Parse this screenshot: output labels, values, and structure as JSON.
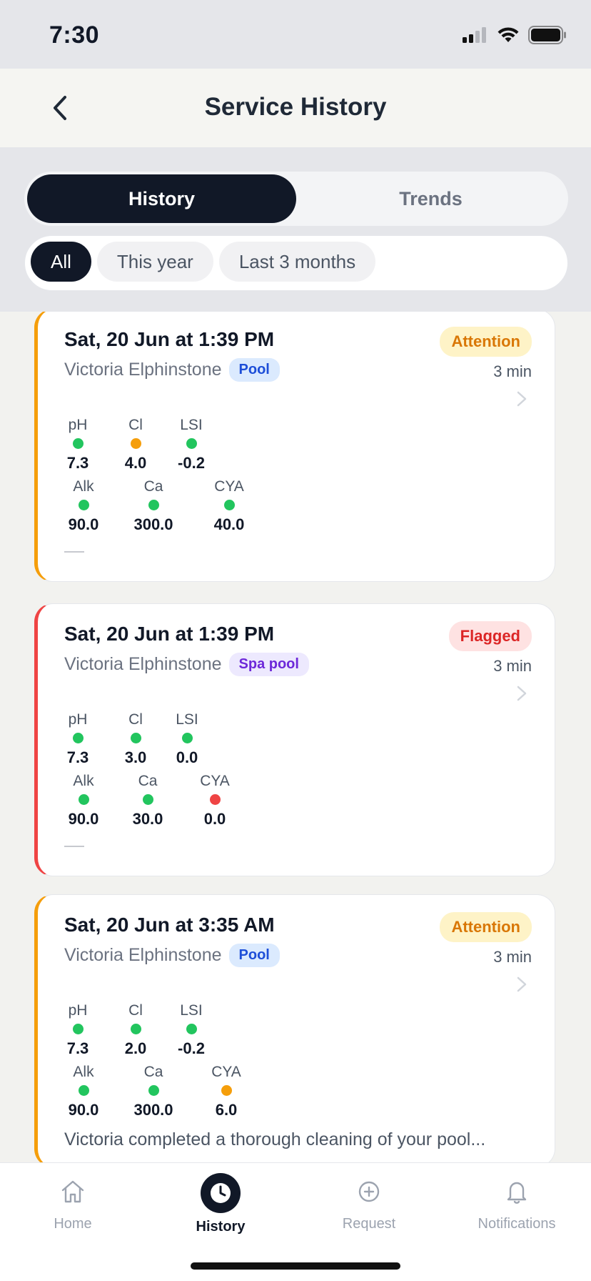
{
  "status_bar": {
    "time": "7:30"
  },
  "header": {
    "title": "Service History"
  },
  "segments": [
    {
      "label": "History",
      "active": true
    },
    {
      "label": "Trends",
      "active": false
    }
  ],
  "filters": [
    {
      "label": "All",
      "active": true
    },
    {
      "label": "This year",
      "active": false
    },
    {
      "label": "Last 3 months",
      "active": false
    }
  ],
  "visits": [
    {
      "date": "Sat, 20 Jun at 1:39 PM",
      "technician": "Victoria Elphinstone",
      "pool_type": "Pool",
      "status": "Attention",
      "duration": "3 min",
      "metrics_row1": [
        {
          "label": "pH",
          "value": "7.3",
          "color": "green"
        },
        {
          "label": "Cl",
          "value": "4.0",
          "color": "orange"
        },
        {
          "label": "LSI",
          "value": "-0.2",
          "color": "green"
        }
      ],
      "metrics_row2": [
        {
          "label": "Alk",
          "value": "90.0",
          "color": "green"
        },
        {
          "label": "Ca",
          "value": "300.0",
          "color": "green"
        },
        {
          "label": "CYA",
          "value": "40.0",
          "color": "green"
        }
      ],
      "note": ""
    },
    {
      "date": "Sat, 20 Jun at 1:39 PM",
      "technician": "Victoria Elphinstone",
      "pool_type": "Spa pool",
      "status": "Flagged",
      "duration": "3 min",
      "metrics_row1": [
        {
          "label": "pH",
          "value": "7.3",
          "color": "green"
        },
        {
          "label": "Cl",
          "value": "3.0",
          "color": "green"
        },
        {
          "label": "LSI",
          "value": "0.0",
          "color": "green"
        }
      ],
      "metrics_row2": [
        {
          "label": "Alk",
          "value": "90.0",
          "color": "green"
        },
        {
          "label": "Ca",
          "value": "30.0",
          "color": "green"
        },
        {
          "label": "CYA",
          "value": "0.0",
          "color": "red"
        }
      ],
      "note": ""
    },
    {
      "date": "Sat, 20 Jun at 3:35 AM",
      "technician": "Victoria Elphinstone",
      "pool_type": "Pool",
      "status": "Attention",
      "duration": "3 min",
      "metrics_row1": [
        {
          "label": "pH",
          "value": "7.3",
          "color": "green"
        },
        {
          "label": "Cl",
          "value": "2.0",
          "color": "green"
        },
        {
          "label": "LSI",
          "value": "-0.2",
          "color": "green"
        }
      ],
      "metrics_row2": [
        {
          "label": "Alk",
          "value": "90.0",
          "color": "green"
        },
        {
          "label": "Ca",
          "value": "300.0",
          "color": "green"
        },
        {
          "label": "CYA",
          "value": "6.0",
          "color": "orange"
        }
      ],
      "note": "Victoria completed a thorough cleaning of your pool..."
    }
  ],
  "tabs": [
    {
      "label": "Home",
      "icon": "home-icon",
      "active": false
    },
    {
      "label": "History",
      "icon": "clock-icon",
      "active": true
    },
    {
      "label": "Request",
      "icon": "plus-circle-icon",
      "active": false
    },
    {
      "label": "Notifications",
      "icon": "bell-icon",
      "active": false
    }
  ],
  "colors": {
    "attention": "#f59e0b",
    "flagged": "#ef4444",
    "ok": "#22c55e",
    "primary": "#111827"
  }
}
